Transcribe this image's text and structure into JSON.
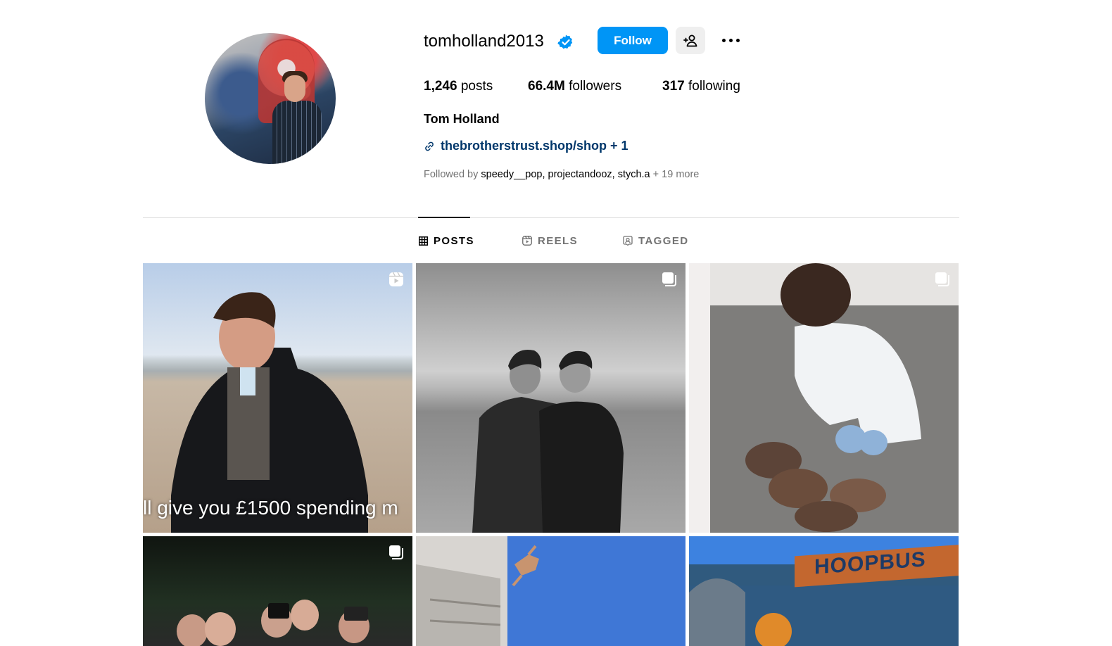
{
  "profile": {
    "username": "tomholland2013",
    "follow_label": "Follow",
    "posts_count": "1,246",
    "posts_label": "posts",
    "followers_count": "66.4M",
    "followers_label": "followers",
    "following_count": "317",
    "following_label": "following",
    "full_name": "Tom Holland",
    "link_text": "thebrotherstrust.shop/shop + 1",
    "followed_by_prefix": "Followed by",
    "followed_by_users": "speedy__pop, projectandooz, stych.a",
    "followed_by_more": "+ 19 more"
  },
  "tabs": [
    {
      "label": "POSTS",
      "icon": "grid-icon",
      "active": true
    },
    {
      "label": "REELS",
      "icon": "reels-icon",
      "active": false
    },
    {
      "label": "TAGGED",
      "icon": "tagged-icon",
      "active": false
    }
  ],
  "posts": [
    {
      "badge": "reel-icon",
      "caption": "ll give you £1500 spending m"
    },
    {
      "badge": "carousel-icon"
    },
    {
      "badge": "carousel-icon"
    },
    {
      "badge": "carousel-icon"
    },
    {
      "badge": ""
    },
    {
      "badge": "",
      "sign_text": "HOOPBUS"
    }
  ],
  "colors": {
    "follow_button": "#0095f6",
    "link": "#00376b",
    "muted": "#737373",
    "verified": "#0095f6"
  }
}
